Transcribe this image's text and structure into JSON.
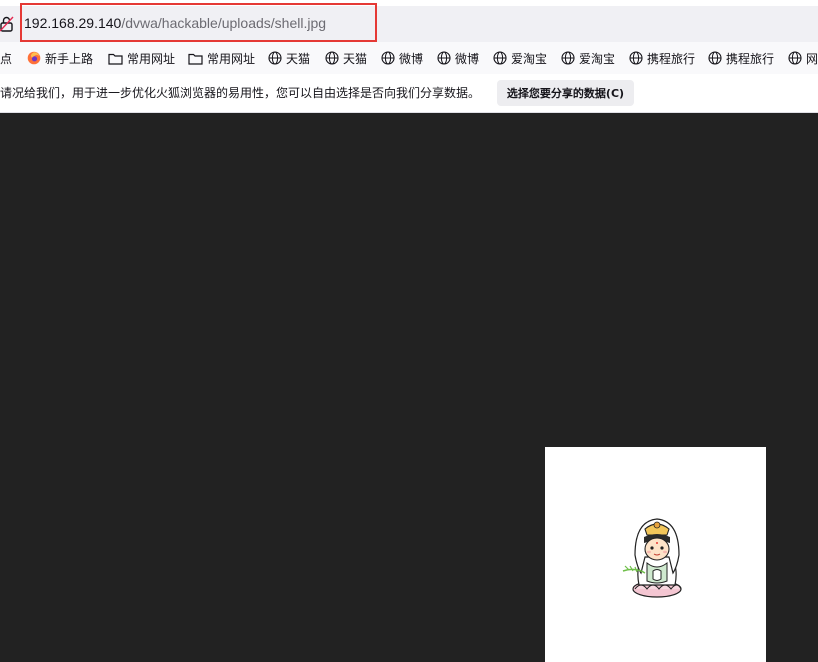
{
  "address_bar": {
    "host": "192.168.29.140",
    "path": "/dvwa/hackable/uploads/shell.jpg",
    "security_icon": "insecure-lock-icon"
  },
  "bookmarks": [
    {
      "label": "点",
      "icon": "none"
    },
    {
      "label": "新手上路",
      "icon": "firefox-icon"
    },
    {
      "label": "常用网址",
      "icon": "folder-icon"
    },
    {
      "label": "常用网址",
      "icon": "folder-icon"
    },
    {
      "label": "天猫",
      "icon": "globe-icon"
    },
    {
      "label": "天猫",
      "icon": "globe-icon"
    },
    {
      "label": "微博",
      "icon": "globe-icon"
    },
    {
      "label": "微博",
      "icon": "globe-icon"
    },
    {
      "label": "爱淘宝",
      "icon": "globe-icon"
    },
    {
      "label": "爱淘宝",
      "icon": "globe-icon"
    },
    {
      "label": "携程旅行",
      "icon": "globe-icon"
    },
    {
      "label": "携程旅行",
      "icon": "globe-icon"
    },
    {
      "label": "网",
      "icon": "globe-icon"
    }
  ],
  "notification": {
    "message": "请况给我们，用于进一步优化火狐浏览器的易用性，您可以自由选择是否向我们分享数据。",
    "button_label": "选择您要分享的数据(C)"
  },
  "viewer": {
    "background": "#222222",
    "image_name": "cartoon-guanyin-image"
  }
}
